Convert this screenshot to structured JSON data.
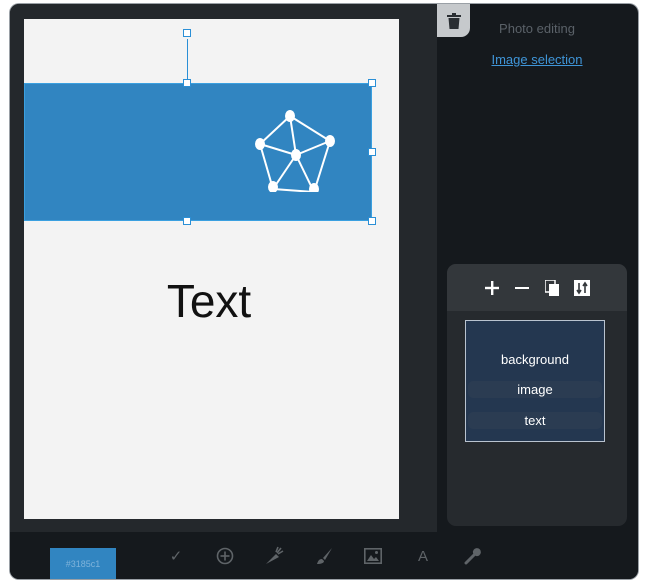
{
  "canvas": {
    "text": "Text",
    "banner_color": "#3185c1"
  },
  "sidebar": {
    "title": "Photo editing",
    "link": "Image selection"
  },
  "layers": [
    {
      "label": "background"
    },
    {
      "label": "image"
    },
    {
      "label": "text"
    }
  ],
  "bottom_bar": {
    "color_value": "#3185c1",
    "tools": [
      "check-icon",
      "add-circle-icon",
      "carrot-icon",
      "brush-icon",
      "image-icon",
      "text-icon",
      "wrench-icon"
    ],
    "text_tool_glyph": "A",
    "check_glyph": "✓"
  },
  "colors": {
    "accent": "#3185c1",
    "link": "#3f95d8",
    "panel": "#24282c",
    "layer_list": "#243750"
  }
}
